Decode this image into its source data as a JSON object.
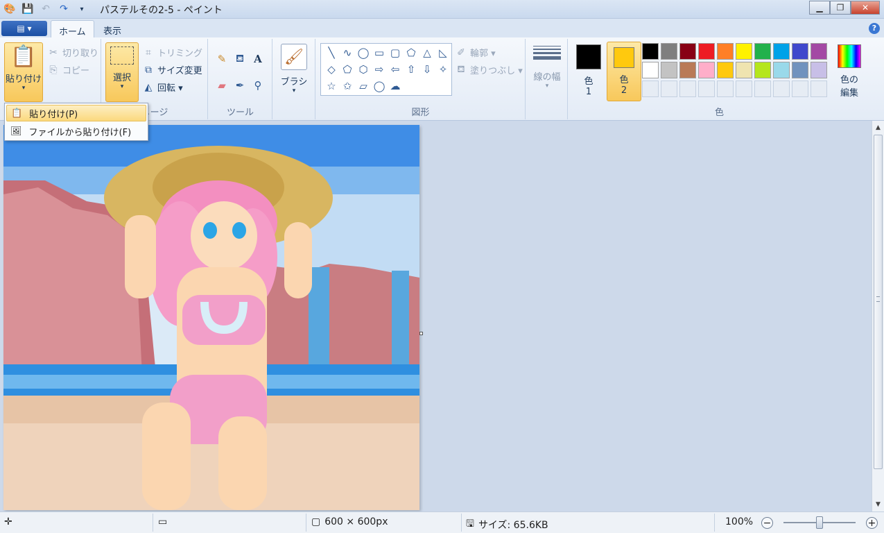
{
  "titlebar": {
    "title": "パステルその2-5 - ペイント",
    "qat_icons": [
      "paint-app-icon",
      "save-icon",
      "undo-icon",
      "redo-icon",
      "customize-dropdown-icon"
    ],
    "minimize": "▁",
    "maximize": "❐",
    "close": "✕"
  },
  "tabs": {
    "file_icon": "▤ ▾",
    "home": "ホーム",
    "view": "表示",
    "help": "?"
  },
  "clipboard": {
    "paste": "貼り付け",
    "cut": "切り取り",
    "copy": "コピー",
    "paste_arrow": "▾"
  },
  "image_group": {
    "label": "メージ",
    "select": "選択",
    "crop": "トリミング",
    "resize": "サイズ変更",
    "rotate": "回転 ▾"
  },
  "tools": {
    "label": "ツール",
    "text_tool": "A"
  },
  "brush": {
    "label": "ブラシ",
    "arrow": "▾"
  },
  "shapes": {
    "label": "図形",
    "glyphs": [
      "╲",
      "∿",
      "◯",
      "▭",
      "▢",
      "⬠",
      "△",
      "◺",
      "◇",
      "⬠",
      "⬡",
      "⇨",
      "⇦",
      "⇧",
      "⇩",
      "✧",
      "☆",
      "✩",
      "▱",
      "◯",
      "☁"
    ],
    "outline": "輪郭 ▾",
    "fill": "塗りつぶし ▾"
  },
  "size": {
    "label": "線の幅",
    "arrow": "▾"
  },
  "colors": {
    "label": "色",
    "color1_label_a": "色",
    "color1_label_b": "1",
    "color2_label_a": "色",
    "color2_label_b": "2",
    "color1": "#000000",
    "color2": "#ffc90e",
    "edit_a": "色の",
    "edit_b": "編集",
    "row1": [
      "#000000",
      "#7f7f7f",
      "#880015",
      "#ed1c24",
      "#ff7f27",
      "#fff200",
      "#22b14c",
      "#00a2e8",
      "#3f48cc",
      "#a349a4"
    ],
    "row2": [
      "#ffffff",
      "#c3c3c3",
      "#b97a57",
      "#ffaec9",
      "#ffc90e",
      "#efe4b0",
      "#b5e61d",
      "#99d9ea",
      "#7092be",
      "#c8bfe7"
    ]
  },
  "paste_menu": {
    "item1": "貼り付け(P)",
    "item2": "ファイルから貼り付け(F)"
  },
  "statusbar": {
    "dimensions": "600 × 600px",
    "filesize": "サイズ: 65.6KB",
    "zoom": "100%",
    "zoom_out": "−",
    "zoom_in": "+"
  }
}
